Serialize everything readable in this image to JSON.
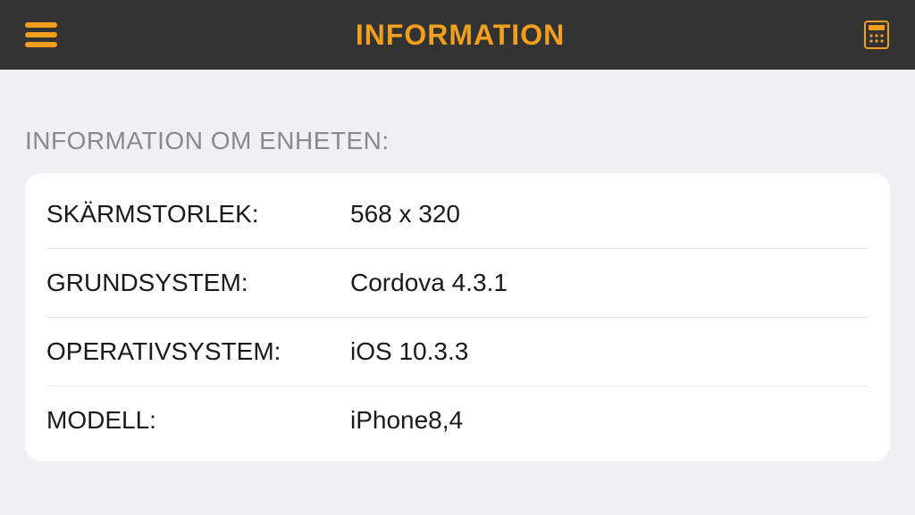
{
  "header": {
    "title": "INFORMATION"
  },
  "section": {
    "title": "INFORMATION OM ENHETEN:"
  },
  "rows": [
    {
      "label": "SKÄRMSTORLEK:",
      "value": "568 x 320"
    },
    {
      "label": "GRUNDSYSTEM:",
      "value": "Cordova 4.3.1"
    },
    {
      "label": "OPERATIVSYSTEM:",
      "value": "iOS 10.3.3"
    },
    {
      "label": "MODELL:",
      "value": "iPhone8,4"
    }
  ],
  "colors": {
    "accent": "#f29f1d",
    "headerBg": "#333333",
    "pageBg": "#efeff4"
  }
}
